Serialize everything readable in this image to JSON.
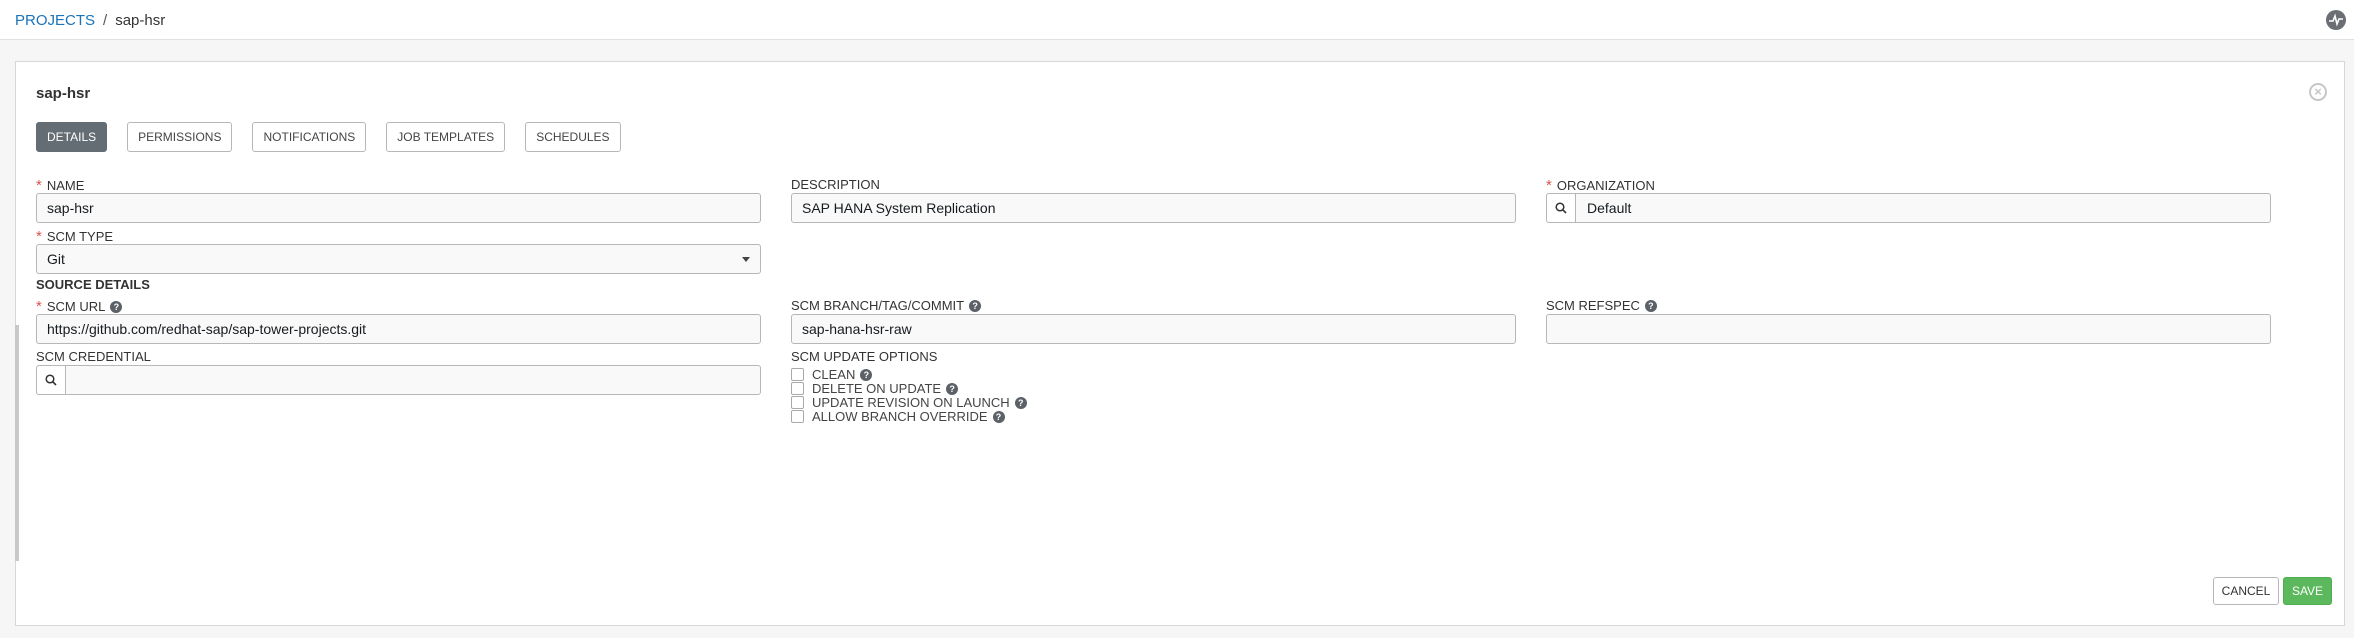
{
  "breadcrumb": {
    "root": "PROJECTS",
    "separator": "/",
    "current": "sap-hsr"
  },
  "panel": {
    "title": "sap-hsr"
  },
  "tabs": [
    {
      "label": "DETAILS",
      "active": true
    },
    {
      "label": "PERMISSIONS",
      "active": false
    },
    {
      "label": "NOTIFICATIONS",
      "active": false
    },
    {
      "label": "JOB TEMPLATES",
      "active": false
    },
    {
      "label": "SCHEDULES",
      "active": false
    }
  ],
  "fields": {
    "name": {
      "label": "NAME",
      "required": "*",
      "value": "sap-hsr"
    },
    "description": {
      "label": "DESCRIPTION",
      "value": "SAP HANA System Replication"
    },
    "organization": {
      "label": "ORGANIZATION",
      "required": "*",
      "value": "Default"
    },
    "scm_type": {
      "label": "SCM TYPE",
      "required": "*",
      "value": "Git"
    },
    "source_details": "SOURCE DETAILS",
    "scm_url": {
      "label": "SCM URL",
      "required": "*",
      "value": "https://github.com/redhat-sap/sap-tower-projects.git"
    },
    "scm_branch": {
      "label": "SCM BRANCH/TAG/COMMIT",
      "value": "sap-hana-hsr-raw"
    },
    "scm_refspec": {
      "label": "SCM REFSPEC",
      "value": ""
    },
    "scm_credential": {
      "label": "SCM CREDENTIAL",
      "value": ""
    },
    "scm_update_options": {
      "label": "SCM UPDATE OPTIONS",
      "options": [
        "CLEAN",
        "DELETE ON UPDATE",
        "UPDATE REVISION ON LAUNCH",
        "ALLOW BRANCH OVERRIDE"
      ]
    }
  },
  "buttons": {
    "cancel": "CANCEL",
    "save": "SAVE"
  },
  "help_glyph": "?",
  "colors": {
    "accent_link": "#1a73b8",
    "save": "#5cb85c",
    "active_tab": "#656d74",
    "required": "#d9534f"
  }
}
